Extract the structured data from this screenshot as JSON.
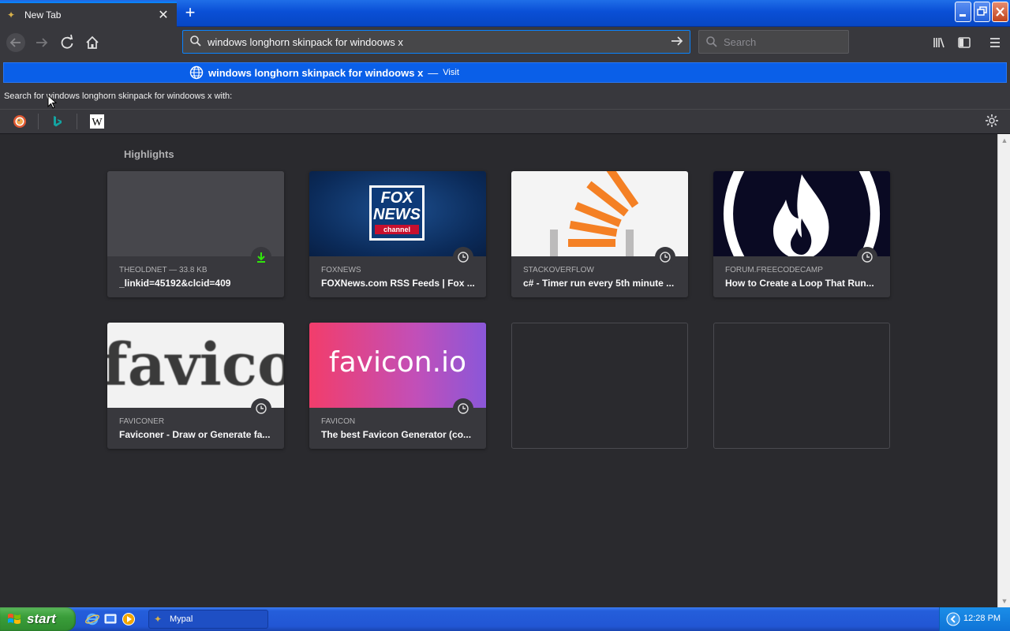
{
  "browser": {
    "tab": {
      "title": "New Tab",
      "close_glyph": "✕",
      "icon": "mypal-icon"
    },
    "new_tab_glyph": "+",
    "window_buttons": {
      "minimize": "_",
      "restore": "❐",
      "close": "✕"
    }
  },
  "toolbar": {
    "back_glyph": "←",
    "forward_glyph": "→",
    "reload_glyph": "↻",
    "home_glyph": "⌂",
    "url_value": "windows longhorn skinpack for windoows x",
    "go_glyph": "→",
    "search_placeholder": "Search",
    "menu_glyph": "≡"
  },
  "autocomplete": {
    "suggestion_text": "windows longhorn skinpack for windoows x",
    "dash": "—",
    "visit_label": "Visit",
    "search_with_label": "Search for windows longhorn skinpack for windoows x with:",
    "engines": [
      "duckduckgo-icon",
      "bing-icon",
      "wikipedia-icon"
    ],
    "settings_glyph": "⚙"
  },
  "content": {
    "highlights_title": "Highlights",
    "cards": [
      {
        "source": "THEOLDNET — 33.8 KB",
        "title": "_linkid=45192&clcid=409",
        "badge": "download-icon"
      },
      {
        "source": "FOXNEWS",
        "title": "FOXNews.com RSS Feeds | Fox ...",
        "badge": "clock-icon"
      },
      {
        "source": "STACKOVERFLOW",
        "title": "c# - Timer run every 5th minute ...",
        "badge": "clock-icon"
      },
      {
        "source": "FORUM.FREECODECAMP",
        "title": "How to Create a Loop That Run...",
        "badge": "clock-icon"
      },
      {
        "source": "FAVICONER",
        "title": "Faviconer - Draw or Generate fa...",
        "badge": "clock-icon"
      },
      {
        "source": "FAVICON",
        "title": "The best Favicon Generator (co...",
        "badge": "clock-icon"
      }
    ],
    "thumbs": {
      "fox_line1": "FOX",
      "fox_line2": "NEWS",
      "fox_line3": "channel",
      "faviconer_text": "favico",
      "faviconio_text": "favicon.io"
    }
  },
  "taskbar": {
    "start_label": "start",
    "task_label": "Mypal",
    "clock": "12:28 PM"
  },
  "colors": {
    "accent": "#0a84ff",
    "suggest_bg": "#0a5fe8",
    "content_bg": "#2a2a2e",
    "card_bg": "#38383d",
    "so_orange": "#f48024",
    "fcc_bg": "#0a0a23"
  }
}
